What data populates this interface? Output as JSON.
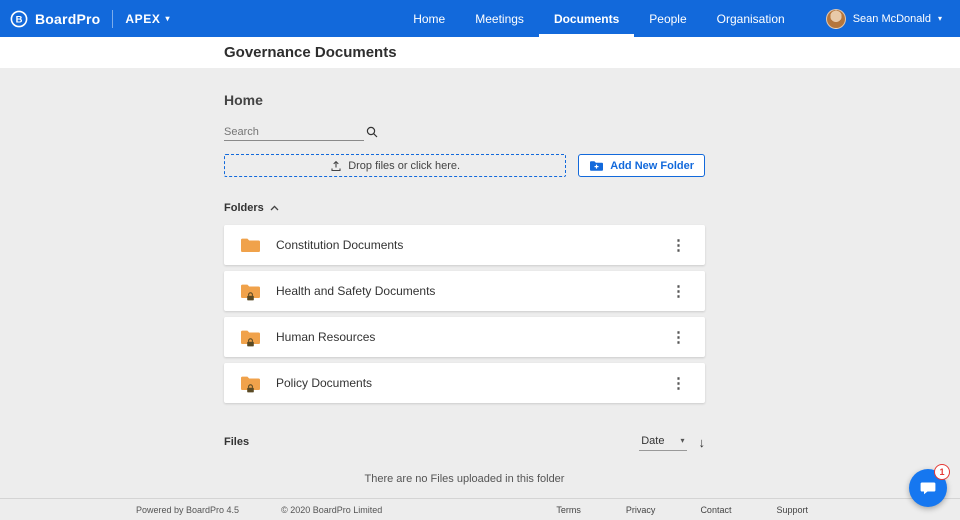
{
  "navbar": {
    "brand": "BoardPro",
    "org": "APEX",
    "items": [
      {
        "label": "Home",
        "active": false
      },
      {
        "label": "Meetings",
        "active": false
      },
      {
        "label": "Documents",
        "active": true
      },
      {
        "label": "People",
        "active": false
      },
      {
        "label": "Organisation",
        "active": false
      }
    ],
    "user": "Sean McDonald"
  },
  "header": {
    "title": "Governance Documents"
  },
  "main": {
    "breadcrumb": "Home",
    "search_placeholder": "Search",
    "dropzone_label": "Drop files or click here.",
    "add_folder_label": "Add New Folder",
    "folders_label": "Folders",
    "folders": [
      {
        "name": "Constitution Documents",
        "locked": false
      },
      {
        "name": "Health and Safety Documents",
        "locked": true
      },
      {
        "name": "Human Resources",
        "locked": true
      },
      {
        "name": "Policy Documents",
        "locked": true
      }
    ],
    "files_label": "Files",
    "sort_value": "Date",
    "empty_message": "There are no Files uploaded in this folder"
  },
  "footer": {
    "powered_by": "Powered by BoardPro 4.5",
    "copyright": "© 2020 BoardPro Limited",
    "links": [
      "Terms",
      "Privacy",
      "Contact",
      "Support"
    ]
  },
  "chat": {
    "badge": "1"
  },
  "colors": {
    "primary": "#1269db",
    "folder": "#f0a24b",
    "badge": "#e53935"
  }
}
